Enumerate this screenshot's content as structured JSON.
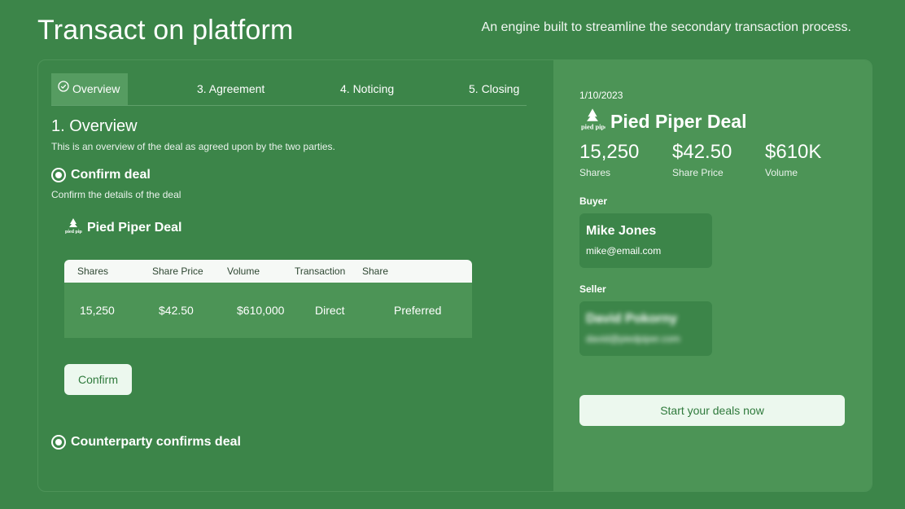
{
  "header": {
    "title": "Transact on platform",
    "subtitle": "An engine built to streamline the secondary transaction process."
  },
  "tabs": [
    {
      "label": "Overview",
      "active": true
    },
    {
      "label": "3. Agreement",
      "active": false
    },
    {
      "label": "4. Noticing",
      "active": false
    },
    {
      "label": "5. Closing",
      "active": false
    }
  ],
  "overview": {
    "title": "1. Overview",
    "description": "This is an overview of the deal as agreed upon by the two parties.",
    "confirm_step": {
      "title": "Confirm deal",
      "description": "Confirm the details of the deal"
    },
    "deal_name": "Pied Piper Deal",
    "table": {
      "headers": [
        "Shares",
        "Share Price",
        "Volume",
        "Transaction",
        "Share"
      ],
      "row": [
        "15,250",
        "$42.50",
        "$610,000",
        "Direct",
        "Preferred"
      ]
    },
    "confirm_button": "Confirm",
    "counterparty_step": "Counterparty confirms deal"
  },
  "summary": {
    "date": "1/10/2023",
    "deal_name": "Pied Piper Deal",
    "stats": [
      {
        "value": "15,250",
        "label": "Shares"
      },
      {
        "value": "$42.50",
        "label": "Share Price"
      },
      {
        "value": "$610K",
        "label": "Volume"
      }
    ],
    "buyer": {
      "label": "Buyer",
      "name": "Mike Jones",
      "email": "mike@email.com"
    },
    "seller": {
      "label": "Seller",
      "name": "David Pokorny",
      "email": "david@piedpiper.com"
    },
    "cta_button": "Start your deals now"
  },
  "colors": {
    "background": "#3c8549",
    "panel": "#4c9456",
    "button_bg": "#ecf8ee",
    "button_text": "#2f7a3c"
  },
  "icons": [
    "check-circle-icon",
    "radio-selected-icon",
    "pied-piper-logo"
  ]
}
